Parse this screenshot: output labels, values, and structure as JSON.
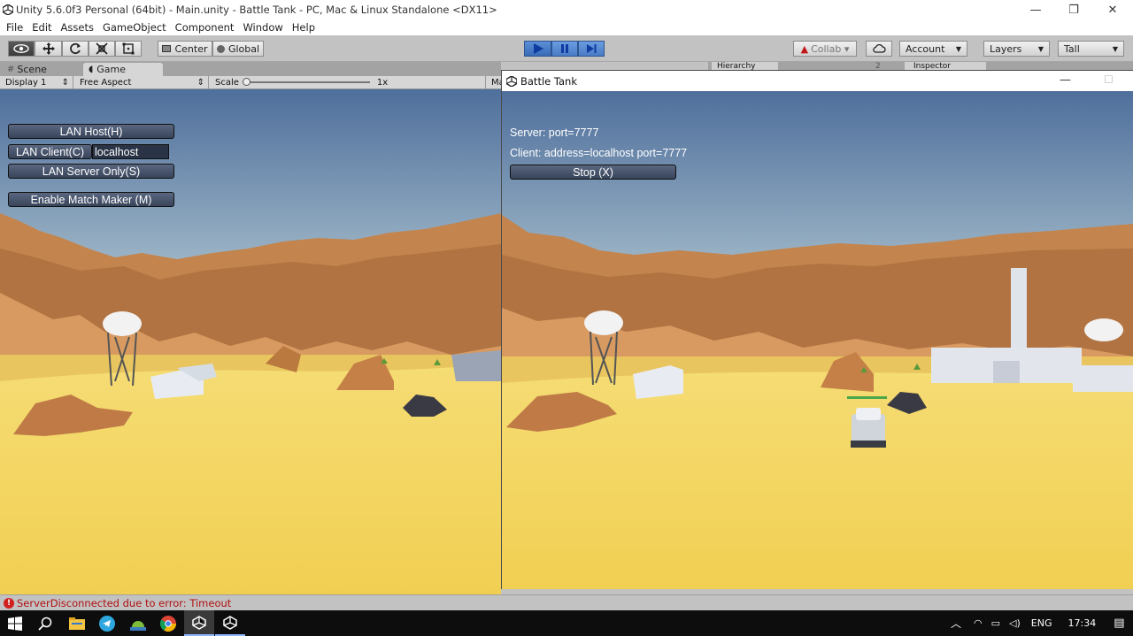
{
  "window": {
    "title": "Unity 5.6.0f3 Personal (64bit) - Main.unity - Battle Tank - PC, Mac & Linux Standalone <DX11>",
    "controls": [
      "—",
      "❐",
      "✕"
    ]
  },
  "menu": [
    "File",
    "Edit",
    "Assets",
    "GameObject",
    "Component",
    "Window",
    "Help"
  ],
  "toolbar": {
    "pivot_label": "Center",
    "space_label": "Global",
    "collab_label": "Collab ▾",
    "account_label": "Account",
    "layers_label": "Layers",
    "layout_label": "Tall",
    "right_tabs": [
      "Hierarchy",
      "2",
      "Inspector"
    ]
  },
  "tabs": {
    "scene": "Scene",
    "game": "Game"
  },
  "game_bar": {
    "display": "Display 1",
    "aspect": "Free Aspect",
    "scale_label": "Scale",
    "scale_value": "1x",
    "maximize_short": "Ma"
  },
  "left_game": {
    "lan_host": "LAN Host(H)",
    "lan_client": "LAN Client(C)",
    "client_address": "localhost",
    "lan_server": "LAN Server Only(S)",
    "match_maker": "Enable Match Maker (M)"
  },
  "battle_window": {
    "title": "Battle Tank",
    "server_info": "Server: port=7777",
    "client_info": "Client: address=localhost port=7777",
    "stop_button": "Stop (X)"
  },
  "status": {
    "message": "ServerDisconnected due to error: Timeout",
    "status_color": "#b01010"
  },
  "taskbar": {
    "lang": "ENG",
    "time": "17:34",
    "apps": [
      "start-icon",
      "search-icon",
      "file-explorer-icon",
      "telegram-icon",
      "android-studio-icon",
      "chrome-icon",
      "unity-icon",
      "unity-icon"
    ]
  },
  "colors": {
    "sky_top": "#4f6f9c",
    "sky_bottom": "#a7bfcc",
    "sand": "#f3d363",
    "rock": "#c88850",
    "play_blue": "#3a6cb6"
  }
}
